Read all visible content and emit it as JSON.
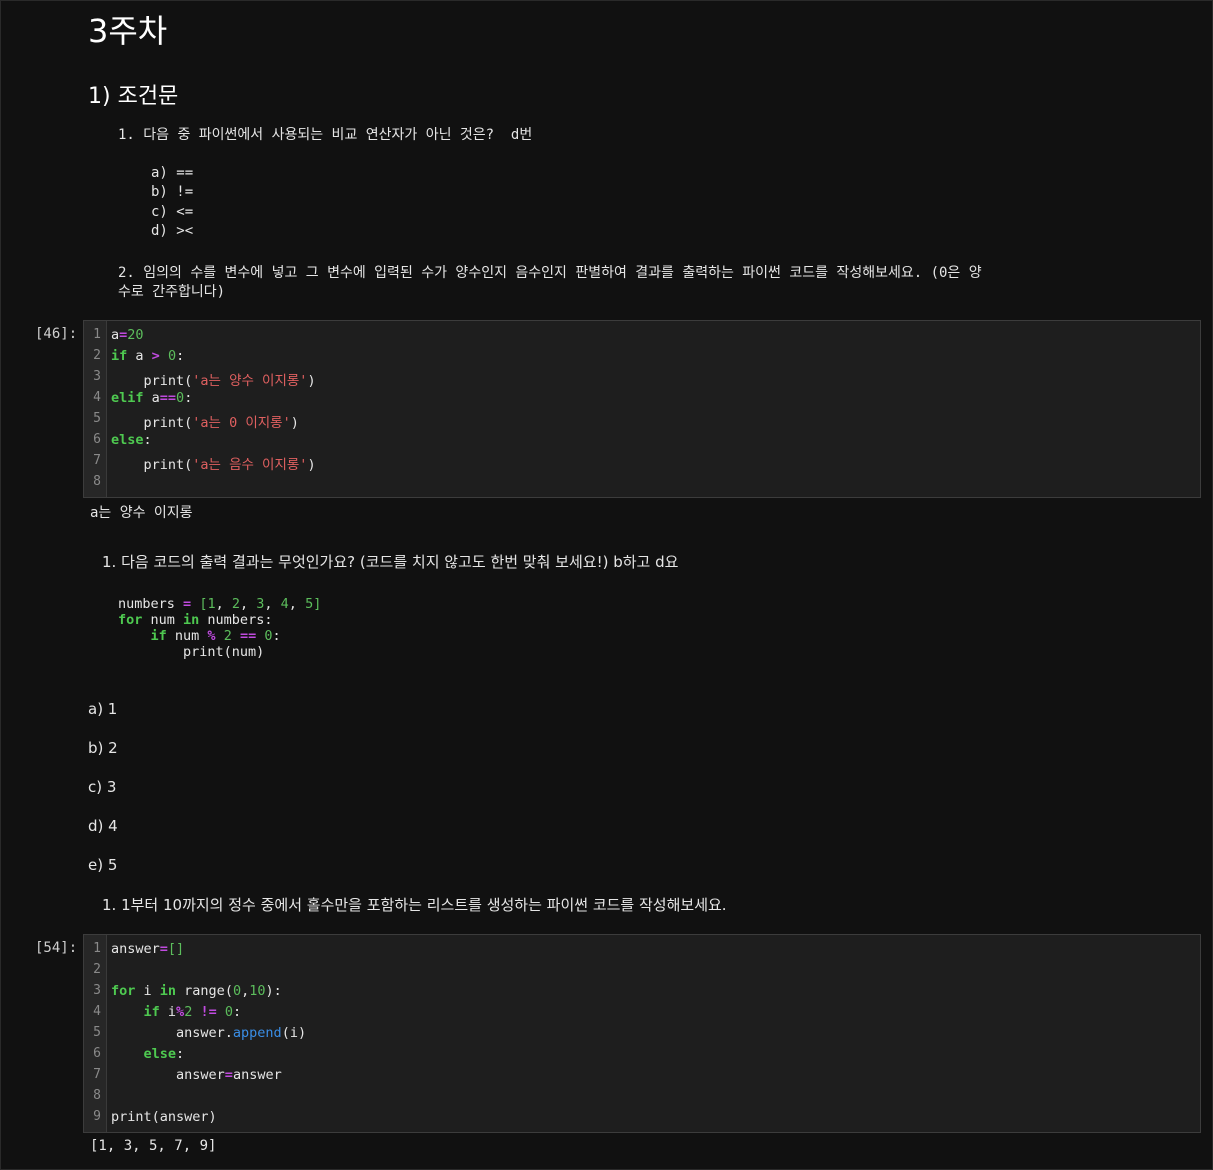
{
  "notebook": {
    "title": "3주차",
    "section": "1) 조건문",
    "q1": {
      "text": "1. 다음 중 파이썬에서 사용되는 비교 연산자가 아닌 것은?  d번",
      "options": [
        "a) ==",
        "b) !=",
        "c) <=",
        "d) ><"
      ]
    },
    "q2": {
      "line1": "2. 임의의 수를 변수에 넣고 그 변수에 입력된 수가 양수인지 음수인지 판별하여 결과를 출력하는 파이썬 코드를 작성해보세요. (0은 양",
      "line2": "수로 간주합니다)"
    },
    "cell1": {
      "prompt": "[46]:",
      "line_numbers": [
        "1",
        "2",
        "3",
        "4",
        "5",
        "6",
        "7",
        "8"
      ],
      "output": "a는 양수 이지롱"
    },
    "q3": {
      "text": "1. 다음 코드의 출력 결과는 무엇인가요? (코드를 치지 않고도 한번 맞춰 보세요!) b하고 d요",
      "options": [
        "a) 1",
        "b) 2",
        "c) 3",
        "d) 4",
        "e) 5"
      ]
    },
    "q4": {
      "text": "1. 1부터 10까지의 정수 중에서 홀수만을 포함하는 리스트를 생성하는 파이썬 코드를 작성해보세요."
    },
    "cell2": {
      "prompt": "[54]:",
      "line_numbers": [
        "1",
        "2",
        "3",
        "4",
        "5",
        "6",
        "7",
        "8",
        "9"
      ],
      "output": "[1, 3, 5, 7, 9]"
    },
    "colors": {
      "background": "#111111",
      "keyword": "#4ec950",
      "number": "#5cbd5c",
      "operator": "#c14be0",
      "string": "#e06060",
      "method": "#3a8ee6"
    }
  }
}
